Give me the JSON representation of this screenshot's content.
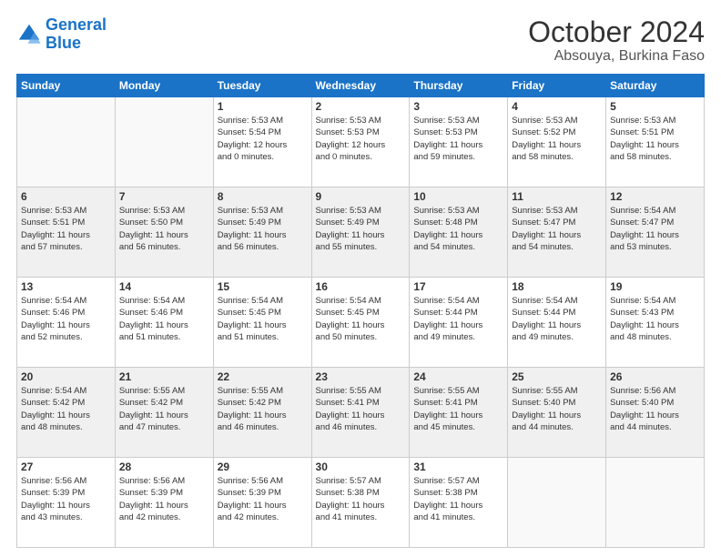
{
  "logo": {
    "line1": "General",
    "line2": "Blue"
  },
  "title": "October 2024",
  "subtitle": "Absouya, Burkina Faso",
  "headers": [
    "Sunday",
    "Monday",
    "Tuesday",
    "Wednesday",
    "Thursday",
    "Friday",
    "Saturday"
  ],
  "weeks": [
    {
      "shade": "white",
      "days": [
        {
          "num": "",
          "info": ""
        },
        {
          "num": "",
          "info": ""
        },
        {
          "num": "1",
          "info": "Sunrise: 5:53 AM\nSunset: 5:54 PM\nDaylight: 12 hours\nand 0 minutes."
        },
        {
          "num": "2",
          "info": "Sunrise: 5:53 AM\nSunset: 5:53 PM\nDaylight: 12 hours\nand 0 minutes."
        },
        {
          "num": "3",
          "info": "Sunrise: 5:53 AM\nSunset: 5:53 PM\nDaylight: 11 hours\nand 59 minutes."
        },
        {
          "num": "4",
          "info": "Sunrise: 5:53 AM\nSunset: 5:52 PM\nDaylight: 11 hours\nand 58 minutes."
        },
        {
          "num": "5",
          "info": "Sunrise: 5:53 AM\nSunset: 5:51 PM\nDaylight: 11 hours\nand 58 minutes."
        }
      ]
    },
    {
      "shade": "shaded",
      "days": [
        {
          "num": "6",
          "info": "Sunrise: 5:53 AM\nSunset: 5:51 PM\nDaylight: 11 hours\nand 57 minutes."
        },
        {
          "num": "7",
          "info": "Sunrise: 5:53 AM\nSunset: 5:50 PM\nDaylight: 11 hours\nand 56 minutes."
        },
        {
          "num": "8",
          "info": "Sunrise: 5:53 AM\nSunset: 5:49 PM\nDaylight: 11 hours\nand 56 minutes."
        },
        {
          "num": "9",
          "info": "Sunrise: 5:53 AM\nSunset: 5:49 PM\nDaylight: 11 hours\nand 55 minutes."
        },
        {
          "num": "10",
          "info": "Sunrise: 5:53 AM\nSunset: 5:48 PM\nDaylight: 11 hours\nand 54 minutes."
        },
        {
          "num": "11",
          "info": "Sunrise: 5:53 AM\nSunset: 5:47 PM\nDaylight: 11 hours\nand 54 minutes."
        },
        {
          "num": "12",
          "info": "Sunrise: 5:54 AM\nSunset: 5:47 PM\nDaylight: 11 hours\nand 53 minutes."
        }
      ]
    },
    {
      "shade": "white",
      "days": [
        {
          "num": "13",
          "info": "Sunrise: 5:54 AM\nSunset: 5:46 PM\nDaylight: 11 hours\nand 52 minutes."
        },
        {
          "num": "14",
          "info": "Sunrise: 5:54 AM\nSunset: 5:46 PM\nDaylight: 11 hours\nand 51 minutes."
        },
        {
          "num": "15",
          "info": "Sunrise: 5:54 AM\nSunset: 5:45 PM\nDaylight: 11 hours\nand 51 minutes."
        },
        {
          "num": "16",
          "info": "Sunrise: 5:54 AM\nSunset: 5:45 PM\nDaylight: 11 hours\nand 50 minutes."
        },
        {
          "num": "17",
          "info": "Sunrise: 5:54 AM\nSunset: 5:44 PM\nDaylight: 11 hours\nand 49 minutes."
        },
        {
          "num": "18",
          "info": "Sunrise: 5:54 AM\nSunset: 5:44 PM\nDaylight: 11 hours\nand 49 minutes."
        },
        {
          "num": "19",
          "info": "Sunrise: 5:54 AM\nSunset: 5:43 PM\nDaylight: 11 hours\nand 48 minutes."
        }
      ]
    },
    {
      "shade": "shaded",
      "days": [
        {
          "num": "20",
          "info": "Sunrise: 5:54 AM\nSunset: 5:42 PM\nDaylight: 11 hours\nand 48 minutes."
        },
        {
          "num": "21",
          "info": "Sunrise: 5:55 AM\nSunset: 5:42 PM\nDaylight: 11 hours\nand 47 minutes."
        },
        {
          "num": "22",
          "info": "Sunrise: 5:55 AM\nSunset: 5:42 PM\nDaylight: 11 hours\nand 46 minutes."
        },
        {
          "num": "23",
          "info": "Sunrise: 5:55 AM\nSunset: 5:41 PM\nDaylight: 11 hours\nand 46 minutes."
        },
        {
          "num": "24",
          "info": "Sunrise: 5:55 AM\nSunset: 5:41 PM\nDaylight: 11 hours\nand 45 minutes."
        },
        {
          "num": "25",
          "info": "Sunrise: 5:55 AM\nSunset: 5:40 PM\nDaylight: 11 hours\nand 44 minutes."
        },
        {
          "num": "26",
          "info": "Sunrise: 5:56 AM\nSunset: 5:40 PM\nDaylight: 11 hours\nand 44 minutes."
        }
      ]
    },
    {
      "shade": "white",
      "days": [
        {
          "num": "27",
          "info": "Sunrise: 5:56 AM\nSunset: 5:39 PM\nDaylight: 11 hours\nand 43 minutes."
        },
        {
          "num": "28",
          "info": "Sunrise: 5:56 AM\nSunset: 5:39 PM\nDaylight: 11 hours\nand 42 minutes."
        },
        {
          "num": "29",
          "info": "Sunrise: 5:56 AM\nSunset: 5:39 PM\nDaylight: 11 hours\nand 42 minutes."
        },
        {
          "num": "30",
          "info": "Sunrise: 5:57 AM\nSunset: 5:38 PM\nDaylight: 11 hours\nand 41 minutes."
        },
        {
          "num": "31",
          "info": "Sunrise: 5:57 AM\nSunset: 5:38 PM\nDaylight: 11 hours\nand 41 minutes."
        },
        {
          "num": "",
          "info": ""
        },
        {
          "num": "",
          "info": ""
        }
      ]
    }
  ]
}
